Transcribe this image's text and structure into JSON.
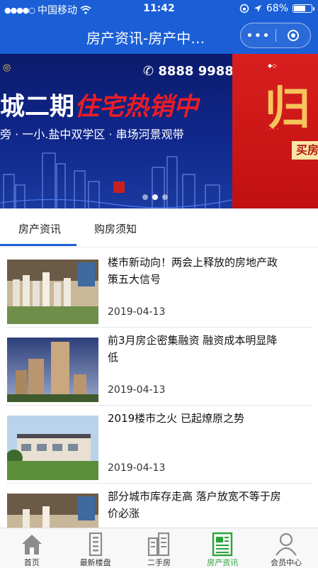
{
  "status_bar": {
    "carrier": "中国移动",
    "time": "11:42",
    "battery": "68%",
    "battery_level": 0.68
  },
  "nav": {
    "title": "房产资讯-房产中…"
  },
  "banner": {
    "phone": "8888 9988",
    "headline_white": "城二期",
    "headline_red": "住宅热销中",
    "subline": "旁 · 一小.盐中双学区 · 串场河景观带",
    "next_slide_big": "归",
    "next_slide_button": "买房",
    "page_count": 3,
    "active_page": 2
  },
  "tabs": [
    {
      "label": "房产资讯",
      "active": true
    },
    {
      "label": "购房须知",
      "active": false
    }
  ],
  "colors": {
    "brand": "#1a5fd6",
    "active_tab": "#2aa43a",
    "banner_red": "#ee1c25"
  },
  "articles": [
    {
      "title": "楼市新动向！两会上释放的房地产政策五大信号",
      "date": "2019-04-13",
      "thumb": "model-sandtable"
    },
    {
      "title": "前3月房企密集融资 融资成本明显降低",
      "date": "2019-04-13",
      "thumb": "tower-render"
    },
    {
      "title": "2019楼市之火 已起燎原之势",
      "date": "2019-04-13",
      "thumb": "villa-render"
    },
    {
      "title": "部分城市库存走高 落户放宽不等于房价必涨",
      "date": "",
      "thumb": "model-sandtable"
    }
  ],
  "tabbar": [
    {
      "label": "首页",
      "icon": "home-icon",
      "active": false
    },
    {
      "label": "最新楼盘",
      "icon": "building-icon",
      "active": false
    },
    {
      "label": "二手房",
      "icon": "apartment-icon",
      "active": false
    },
    {
      "label": "房产资讯",
      "icon": "news-icon",
      "active": true
    },
    {
      "label": "会员中心",
      "icon": "user-icon",
      "active": false
    }
  ]
}
